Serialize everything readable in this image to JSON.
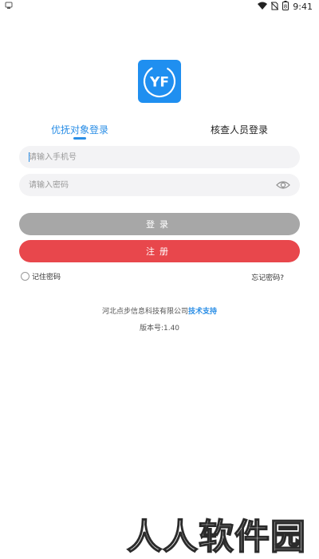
{
  "status_bar": {
    "time": "9:41",
    "battery_level": "8"
  },
  "logo": {
    "text": "YF",
    "color": "#1f8ff0"
  },
  "tabs": [
    {
      "label": "优抚对象登录",
      "active": true
    },
    {
      "label": "核查人员登录",
      "active": false
    }
  ],
  "form": {
    "phone_placeholder": "请输入手机号",
    "phone_value": "",
    "password_placeholder": "请输入密码",
    "password_value": ""
  },
  "buttons": {
    "login_label": "登录",
    "register_label": "注册"
  },
  "options": {
    "remember_label": "记住密码",
    "remember_checked": false,
    "forgot_label": "忘记密码?"
  },
  "footer": {
    "company": "河北点步信息科技有限公司",
    "support": "技术支持",
    "version": "版本号:1.40"
  },
  "watermark": {
    "text": "人人软件园"
  },
  "colors": {
    "accent": "#2a8ee6",
    "register_red": "#e8474c",
    "login_gray": "#a7a7a7",
    "input_bg": "#f3f3f5"
  }
}
